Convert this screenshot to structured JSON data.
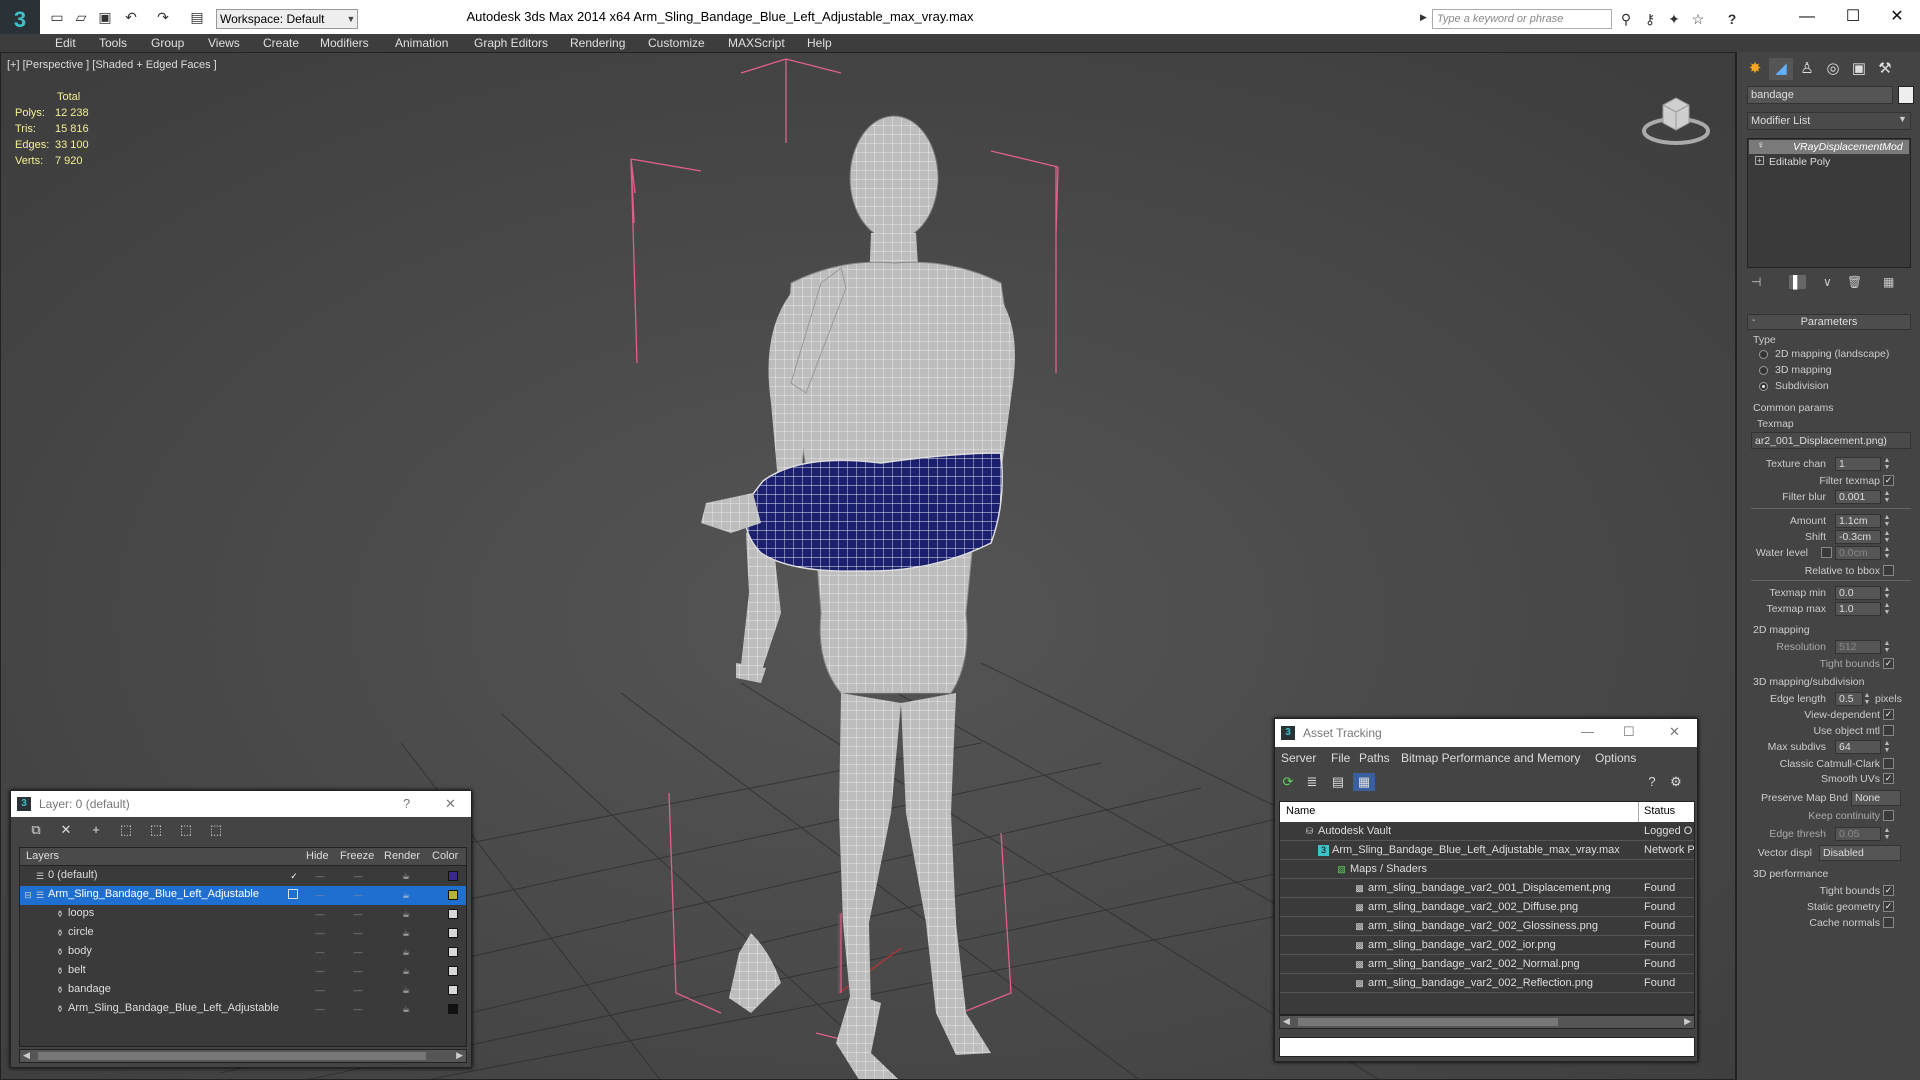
{
  "title_bar": {
    "app_logo": "3",
    "workspace": "Workspace: Default",
    "title": "Autodesk 3ds Max  2014 x64      Arm_Sling_Bandage_Blue_Left_Adjustable_max_vray.max",
    "search_placeholder": "Type a keyword or phrase",
    "help": "?",
    "minimize": "—",
    "maximize": "☐",
    "close": "✕"
  },
  "menu": [
    "Edit",
    "Tools",
    "Group",
    "Views",
    "Create",
    "Modifiers",
    "Animation",
    "Graph Editors",
    "Rendering",
    "Customize",
    "MAXScript",
    "Help"
  ],
  "viewport": {
    "label": "[+] [Perspective ] [Shaded + Edged Faces ]",
    "stats": {
      "total_label": "Total",
      "rows": [
        {
          "label": "Polys:",
          "value": "12 238"
        },
        {
          "label": "Tris:",
          "value": "15 816"
        },
        {
          "label": "Edges:",
          "value": "33 100"
        },
        {
          "label": "Verts:",
          "value": "7 920"
        }
      ]
    }
  },
  "command_panel": {
    "object_name": "bandage",
    "modifier_list": "Modifier List",
    "stack": [
      "VRayDisplacementMod",
      "Editable Poly"
    ],
    "rollout_title": "Parameters",
    "type_group": "Type",
    "type_options": [
      "2D mapping (landscape)",
      "3D mapping",
      "Subdivision"
    ],
    "common_params": "Common params",
    "texmap_label": "Texmap",
    "texmap_value": "ar2_001_Displacement.png)",
    "texture_chan": {
      "label": "Texture chan",
      "value": "1"
    },
    "filter_texmap": "Filter texmap",
    "filter_blur": {
      "label": "Filter blur",
      "value": "0.001"
    },
    "amount": {
      "label": "Amount",
      "value": "1.1cm"
    },
    "shift": {
      "label": "Shift",
      "value": "-0.3cm"
    },
    "water_level": {
      "label": "Water level",
      "value": "0.0cm"
    },
    "relative_to_bbox": "Relative to bbox",
    "texmap_min": {
      "label": "Texmap min",
      "value": "0.0"
    },
    "texmap_max": {
      "label": "Texmap max",
      "value": "1.0"
    },
    "mapping_2d": "2D mapping",
    "resolution": {
      "label": "Resolution",
      "value": "512"
    },
    "tight_bounds": "Tight bounds",
    "mapping_3d": "3D mapping/subdivision",
    "edge_length": {
      "label": "Edge length",
      "value": "0.5",
      "unit": "pixels"
    },
    "view_dependent": "View-dependent",
    "use_object_mtl": "Use object mtl",
    "max_subdivs": {
      "label": "Max subdivs",
      "value": "64"
    },
    "classic_catmull": "Classic Catmull-Clark",
    "smooth_uvs": "Smooth UVs",
    "preserve_map_bnd": {
      "label": "Preserve Map Bnd",
      "value": "None"
    },
    "keep_continuity": "Keep continuity",
    "edge_thresh": {
      "label": "Edge thresh",
      "value": "0.05"
    },
    "vector_displ": {
      "label": "Vector displ",
      "value": "Disabled"
    },
    "perf_3d": "3D performance",
    "tight_bounds_2": "Tight bounds",
    "static_geometry": "Static geometry",
    "cache_normals": "Cache normals"
  },
  "layer_window": {
    "title": "Layer: 0 (default)",
    "help": "?",
    "close": "✕",
    "headers": {
      "layers": "Layers",
      "hide": "Hide",
      "freeze": "Freeze",
      "render": "Render",
      "color": "Color"
    },
    "rows": [
      {
        "name": "0 (default)",
        "color": "#3b2a8a"
      },
      {
        "name": "Arm_Sling_Bandage_Blue_Left_Adjustable",
        "color": "#b4b43a"
      },
      {
        "name": "loops",
        "color": "#d8d8d8"
      },
      {
        "name": "circle",
        "color": "#d8d8d8"
      },
      {
        "name": "body",
        "color": "#d8d8d8"
      },
      {
        "name": "belt",
        "color": "#d8d8d8"
      },
      {
        "name": "bandage",
        "color": "#d8d8d8"
      },
      {
        "name": "Arm_Sling_Bandage_Blue_Left_Adjustable",
        "color": "#111111"
      }
    ],
    "check": "✓"
  },
  "asset_window": {
    "title": "Asset Tracking",
    "minimize": "—",
    "maximize": "☐",
    "close": "✕",
    "menu": [
      "Server",
      "File",
      "Paths",
      "Bitmap Performance and Memory",
      "Options"
    ],
    "headers": {
      "name": "Name",
      "status": "Status"
    },
    "rows": [
      {
        "name": "Autodesk Vault",
        "status": "Logged O",
        "indent": 1
      },
      {
        "name": "Arm_Sling_Bandage_Blue_Left_Adjustable_max_vray.max",
        "status": "Network P",
        "indent": 2
      },
      {
        "name": "Maps / Shaders",
        "status": "",
        "indent": 3
      },
      {
        "name": "arm_sling_bandage_var2_001_Displacement.png",
        "status": "Found",
        "indent": 4
      },
      {
        "name": "arm_sling_bandage_var2_002_Diffuse.png",
        "status": "Found",
        "indent": 4
      },
      {
        "name": "arm_sling_bandage_var2_002_Glossiness.png",
        "status": "Found",
        "indent": 4
      },
      {
        "name": "arm_sling_bandage_var2_002_ior.png",
        "status": "Found",
        "indent": 4
      },
      {
        "name": "arm_sling_bandage_var2_002_Normal.png",
        "status": "Found",
        "indent": 4
      },
      {
        "name": "arm_sling_bandage_var2_002_Reflection.png",
        "status": "Found",
        "indent": 4
      }
    ]
  },
  "colors": {
    "accent": "#3fc1c9",
    "selection": "#1f6fd1",
    "stats_text": "#f4f094",
    "bbox_pink": "#e0608a",
    "bandage_blue": "#1a1f6e"
  }
}
